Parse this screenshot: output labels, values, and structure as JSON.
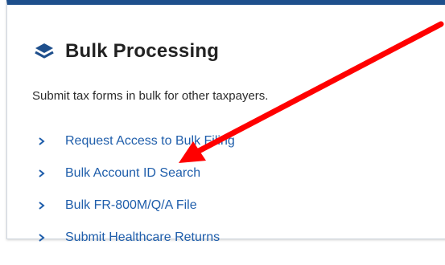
{
  "section": {
    "icon": "layers-icon",
    "title": "Bulk Processing",
    "description": "Submit tax forms in bulk for other taxpayers."
  },
  "links": [
    {
      "label": "Request Access to Bulk Filing",
      "icon": "chevron-right-icon"
    },
    {
      "label": "Bulk Account ID Search",
      "icon": "chevron-right-icon"
    },
    {
      "label": "Bulk FR-800M/Q/A File",
      "icon": "chevron-right-icon"
    },
    {
      "label": "Submit Healthcare Returns",
      "icon": "chevron-right-icon"
    }
  ],
  "annotation": {
    "type": "red-arrow",
    "target": "Bulk Account ID Search"
  },
  "colors": {
    "accent": "#1e4f8c",
    "link": "#1f5eab",
    "arrow": "#ff0000",
    "text": "#222222"
  }
}
